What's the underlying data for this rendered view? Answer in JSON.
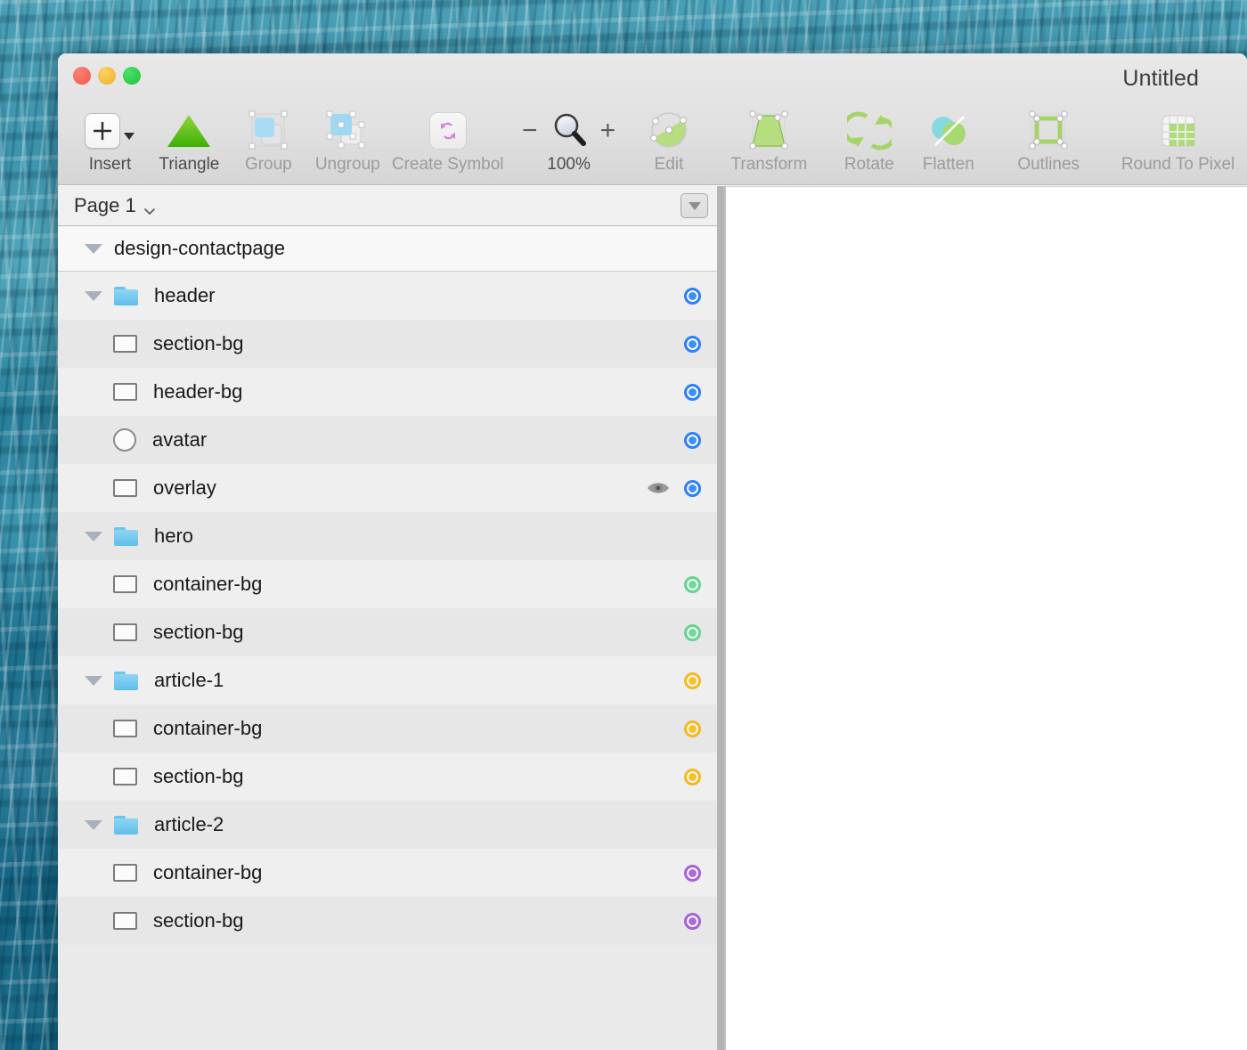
{
  "window": {
    "title": "Untitled",
    "traffic_lights": [
      "close",
      "minimize",
      "maximize"
    ]
  },
  "toolbar": {
    "items": [
      {
        "label": "Insert",
        "icon": "plus-icon",
        "enabled": true,
        "kind": "insert"
      },
      {
        "label": "Triangle",
        "icon": "triangle-icon",
        "enabled": true,
        "kind": "shape"
      },
      {
        "label": "Group",
        "icon": "group-icon",
        "enabled": false,
        "kind": "plain"
      },
      {
        "label": "Ungroup",
        "icon": "ungroup-icon",
        "enabled": false,
        "kind": "plain"
      },
      {
        "label": "Create Symbol",
        "icon": "create-symbol-icon",
        "enabled": false,
        "kind": "plain"
      },
      {
        "label": "100%",
        "icon": "magnifier-icon",
        "enabled": true,
        "kind": "zoom"
      },
      {
        "label": "Edit",
        "icon": "edit-node-icon",
        "enabled": false,
        "kind": "plain"
      },
      {
        "label": "Transform",
        "icon": "transform-icon",
        "enabled": false,
        "kind": "plain"
      },
      {
        "label": "Rotate",
        "icon": "rotate-icon",
        "enabled": false,
        "kind": "plain"
      },
      {
        "label": "Flatten",
        "icon": "flatten-icon",
        "enabled": false,
        "kind": "plain"
      },
      {
        "label": "Outlines",
        "icon": "outlines-icon",
        "enabled": false,
        "kind": "plain"
      },
      {
        "label": "Round To Pixel",
        "icon": "round-to-pixel-icon",
        "enabled": false,
        "kind": "plain"
      }
    ],
    "zoom_level": "100%",
    "zoom_out_label": "−",
    "zoom_in_label": "+"
  },
  "layer_panel": {
    "page_name": "Page 1",
    "page_chevron_icon": "chevron-down-icon",
    "filter_button_icon": "filter-triangle-icon",
    "root": {
      "label": "design-contactpage",
      "expanded": true,
      "disclosure_icon": "triangle-down-icon"
    },
    "rows": [
      {
        "label": "header",
        "icon": "folder-icon",
        "depth": 1,
        "expanded": true,
        "dot": "blue",
        "eye": false
      },
      {
        "label": "section-bg",
        "icon": "rect-icon",
        "depth": 2,
        "expanded": null,
        "dot": "blue",
        "eye": false
      },
      {
        "label": "header-bg",
        "icon": "rect-icon",
        "depth": 2,
        "expanded": null,
        "dot": "blue",
        "eye": false
      },
      {
        "label": "avatar",
        "icon": "circle-icon",
        "depth": 2,
        "expanded": null,
        "dot": "blue",
        "eye": false
      },
      {
        "label": "overlay",
        "icon": "rect-icon",
        "depth": 2,
        "expanded": null,
        "dot": "blue",
        "eye": true
      },
      {
        "label": "hero",
        "icon": "folder-icon",
        "depth": 1,
        "expanded": true,
        "dot": "none",
        "eye": false
      },
      {
        "label": "container-bg",
        "icon": "rect-icon",
        "depth": 2,
        "expanded": null,
        "dot": "green",
        "eye": false
      },
      {
        "label": "section-bg",
        "icon": "rect-icon",
        "depth": 2,
        "expanded": null,
        "dot": "green",
        "eye": false
      },
      {
        "label": "article-1",
        "icon": "folder-icon",
        "depth": 1,
        "expanded": true,
        "dot": "orange",
        "eye": false
      },
      {
        "label": "container-bg",
        "icon": "rect-icon",
        "depth": 2,
        "expanded": null,
        "dot": "orange",
        "eye": false
      },
      {
        "label": "section-bg",
        "icon": "rect-icon",
        "depth": 2,
        "expanded": null,
        "dot": "orange",
        "eye": false
      },
      {
        "label": "article-2",
        "icon": "folder-icon",
        "depth": 1,
        "expanded": true,
        "dot": "none",
        "eye": false
      },
      {
        "label": "container-bg",
        "icon": "rect-icon",
        "depth": 2,
        "expanded": null,
        "dot": "purple",
        "eye": false
      },
      {
        "label": "section-bg",
        "icon": "rect-icon",
        "depth": 2,
        "expanded": null,
        "dot": "purple",
        "eye": false
      }
    ]
  },
  "colors": {
    "dot_blue": "#3e8ffb",
    "dot_green": "#6fd998",
    "dot_orange": "#fcc01f",
    "dot_purple": "#ab6ade",
    "folder_blue": "#6bc4ee",
    "triangle_tool_green": "#5fc21a",
    "toolbar_bg": "#e3e2e3",
    "row_odd": "#efefef",
    "row_even": "#e7e7e7",
    "panel_bg": "#eaeaea",
    "canvas_bg": "#ffffff"
  }
}
